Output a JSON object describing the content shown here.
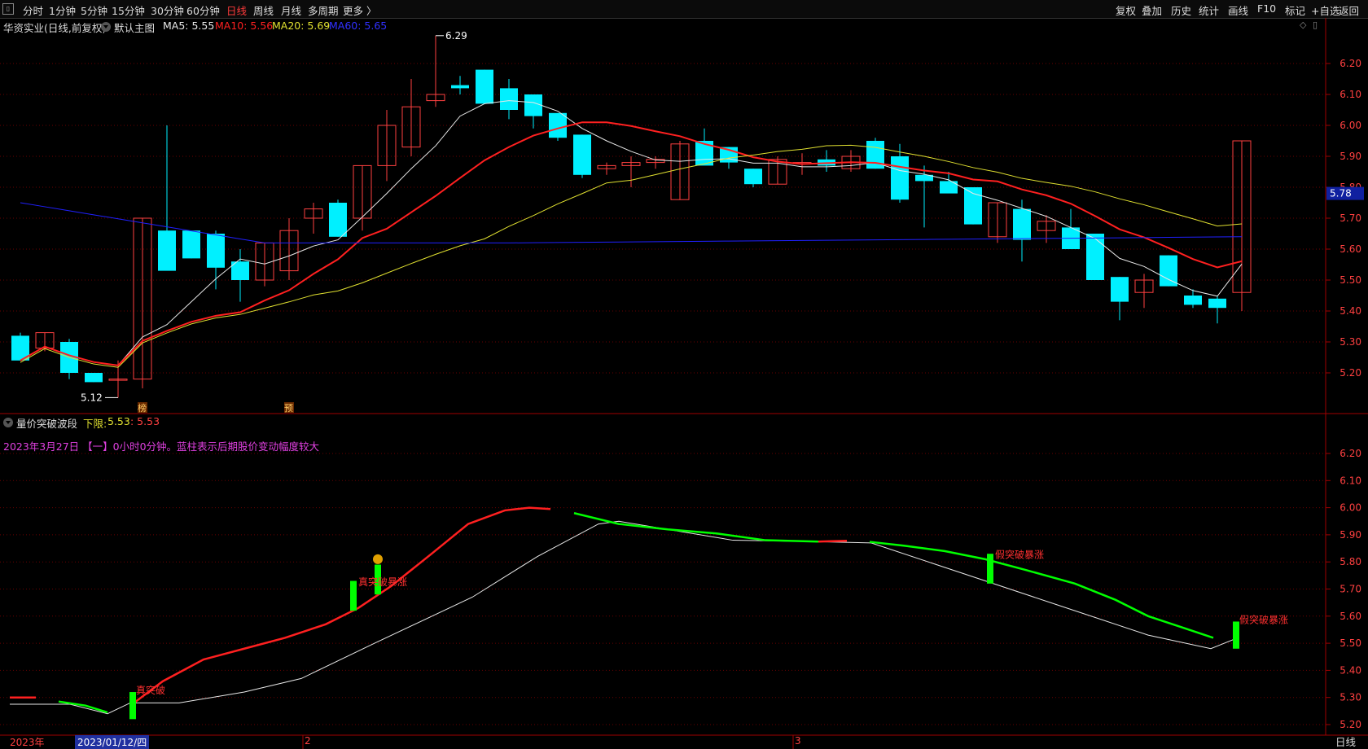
{
  "toolbar": {
    "left": [
      "分时",
      "1分钟",
      "5分钟",
      "15分钟",
      "30分钟",
      "60分钟",
      "日线",
      "周线",
      "月线",
      "多周期",
      "更多 〉"
    ],
    "active_index": 6,
    "right": [
      "复权",
      "叠加",
      "历史",
      "统计",
      "画线",
      "F10",
      "+自选",
      "返回"
    ],
    "mark_label": "标记"
  },
  "main_panel": {
    "stock_title": "华资实业(日线,前复权)",
    "view_label": "默认主图",
    "ma5": "MA5: 5.55",
    "ma10": "MA10: 5.56",
    "ma20": "MA20: 5.69",
    "ma60": "MA60: 5.65",
    "high_label": "6.29",
    "low_label": "5.12",
    "current_price": "5.78",
    "y_ticks": [
      "6.20",
      "6.10",
      "6.00",
      "5.90",
      "5.80",
      "5.70",
      "5.60",
      "5.50",
      "5.40",
      "5.30",
      "5.20"
    ],
    "marker_left": "榜",
    "marker_right": "预"
  },
  "sub_panel": {
    "indicator_name": "量价突破波段",
    "lower_label": "下限:",
    "lower_value1": "5.53",
    "lower_value2": ": 5.53",
    "info_text": "2023年3月27日 【一】0小时0分钟。蓝柱表示后期股价变动幅度较大",
    "y_ticks": [
      "6.20",
      "6.10",
      "6.00",
      "5.90",
      "5.80",
      "5.70",
      "5.60",
      "5.50",
      "5.40",
      "5.30",
      "5.20"
    ],
    "annotations": [
      "真突破",
      "真突破暴涨",
      "假突破暴涨",
      "假突破暴涨"
    ]
  },
  "x_axis": {
    "year_label": "2023年",
    "cursor_date": "2023/01/12/四",
    "month2": "2",
    "month3": "3",
    "period_label": "日线"
  },
  "chart_data": {
    "type": "candlestick",
    "y_range": [
      5.15,
      6.29
    ],
    "candles": [
      [
        5.32,
        5.33,
        5.24,
        5.24
      ],
      [
        5.28,
        5.33,
        5.27,
        5.33
      ],
      [
        5.3,
        5.31,
        5.18,
        5.2
      ],
      [
        5.2,
        5.2,
        5.17,
        5.17
      ],
      [
        5.18,
        5.24,
        5.12,
        5.18
      ],
      [
        5.18,
        5.7,
        5.15,
        5.7
      ],
      [
        5.66,
        6.0,
        5.57,
        5.53
      ],
      [
        5.66,
        5.66,
        5.57,
        5.57
      ],
      [
        5.65,
        5.66,
        5.47,
        5.54
      ],
      [
        5.56,
        5.6,
        5.43,
        5.5
      ],
      [
        5.5,
        5.62,
        5.48,
        5.62
      ],
      [
        5.53,
        5.7,
        5.5,
        5.66
      ],
      [
        5.7,
        5.75,
        5.65,
        5.73
      ],
      [
        5.75,
        5.76,
        5.64,
        5.64
      ],
      [
        5.7,
        5.87,
        5.66,
        5.87
      ],
      [
        5.87,
        6.05,
        5.82,
        6.0
      ],
      [
        5.93,
        6.15,
        5.9,
        6.06
      ],
      [
        6.08,
        6.29,
        6.06,
        6.1
      ],
      [
        6.13,
        6.16,
        6.1,
        6.12
      ],
      [
        6.18,
        6.18,
        6.07,
        6.07
      ],
      [
        6.12,
        6.15,
        6.02,
        6.05
      ],
      [
        6.1,
        6.1,
        5.99,
        6.03
      ],
      [
        6.04,
        6.04,
        5.95,
        5.96
      ],
      [
        5.97,
        5.97,
        5.83,
        5.84
      ],
      [
        5.86,
        5.88,
        5.84,
        5.87
      ],
      [
        5.87,
        5.9,
        5.8,
        5.88
      ],
      [
        5.88,
        5.9,
        5.86,
        5.89
      ],
      [
        5.76,
        5.95,
        5.76,
        5.94
      ],
      [
        5.95,
        5.99,
        5.88,
        5.87
      ],
      [
        5.93,
        5.93,
        5.86,
        5.88
      ],
      [
        5.86,
        5.86,
        5.8,
        5.81
      ],
      [
        5.81,
        5.9,
        5.81,
        5.89
      ],
      [
        5.88,
        5.91,
        5.84,
        5.88
      ],
      [
        5.89,
        5.92,
        5.85,
        5.87
      ],
      [
        5.86,
        5.92,
        5.85,
        5.9
      ],
      [
        5.95,
        5.96,
        5.86,
        5.86
      ],
      [
        5.9,
        5.94,
        5.75,
        5.76
      ],
      [
        5.84,
        5.87,
        5.67,
        5.82
      ],
      [
        5.82,
        5.85,
        5.81,
        5.78
      ],
      [
        5.8,
        5.8,
        5.68,
        5.68
      ],
      [
        5.64,
        5.75,
        5.62,
        5.75
      ],
      [
        5.73,
        5.76,
        5.56,
        5.63
      ],
      [
        5.66,
        5.71,
        5.62,
        5.69
      ],
      [
        5.67,
        5.73,
        5.6,
        5.6
      ],
      [
        5.65,
        5.65,
        5.5,
        5.5
      ],
      [
        5.51,
        5.51,
        5.37,
        5.43
      ],
      [
        5.46,
        5.52,
        5.41,
        5.5
      ],
      [
        5.58,
        5.58,
        5.48,
        5.48
      ],
      [
        5.45,
        5.47,
        5.41,
        5.42
      ],
      [
        5.44,
        5.45,
        5.36,
        5.41
      ],
      [
        5.46,
        5.95,
        5.4,
        5.95
      ]
    ]
  },
  "colors": {
    "up": "#ff4040",
    "down": "#00f0ff",
    "ma5": "#e8e8e8",
    "ma10": "#ff2020",
    "ma20": "#e0e030",
    "ma60": "#2020ff",
    "grid": "#6a0000",
    "axis_text": "#ff4040",
    "green": "#00ff00"
  }
}
